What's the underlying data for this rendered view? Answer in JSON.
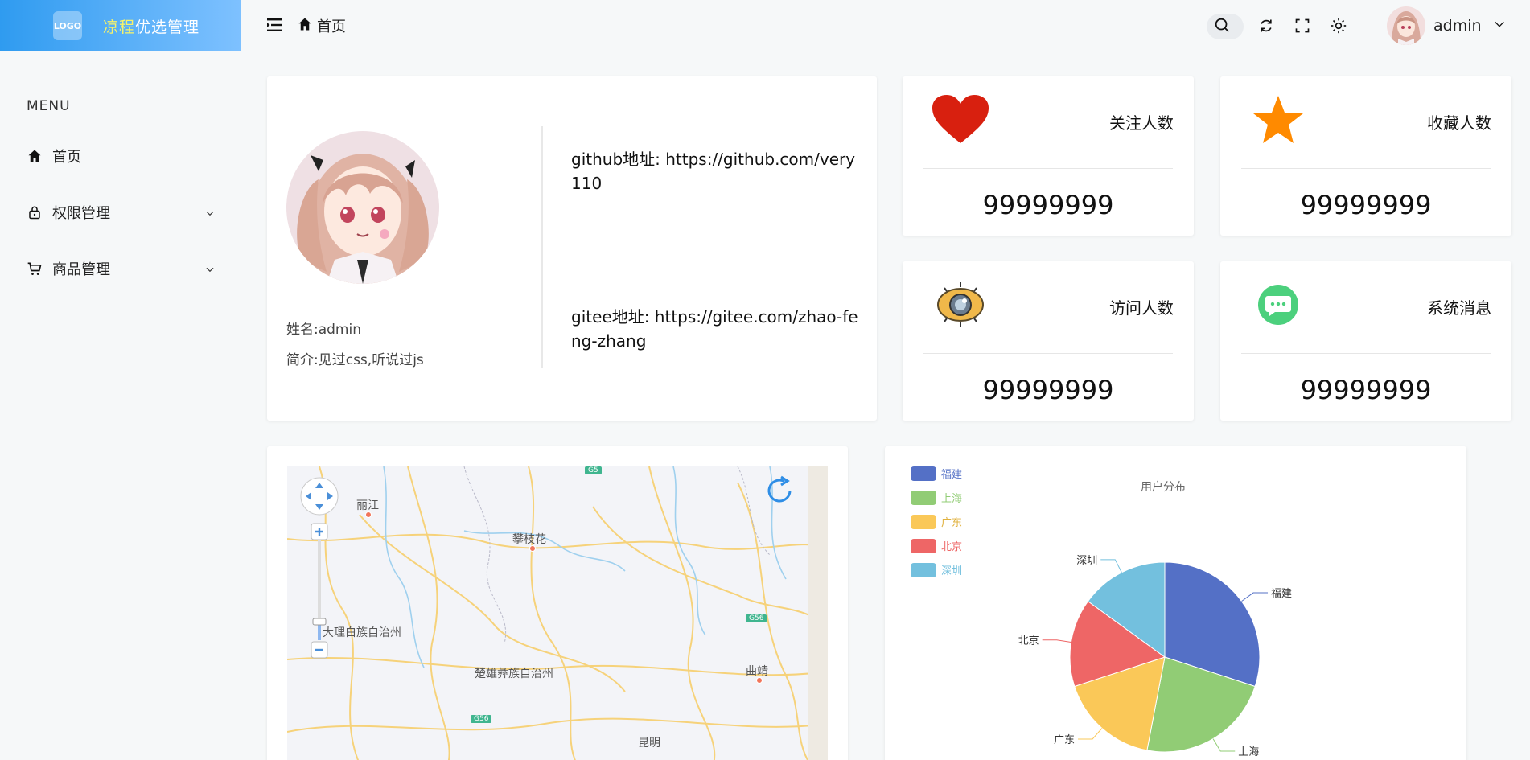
{
  "logo": {
    "box_text": "LOGO",
    "title_part1": "凉程",
    "title_part2": "优选管理"
  },
  "sidebar": {
    "menu_title": "MENU",
    "items": [
      {
        "label": "首页",
        "icon": "home-icon"
      },
      {
        "label": "权限管理",
        "icon": "lock-icon"
      },
      {
        "label": "商品管理",
        "icon": "cart-icon"
      }
    ]
  },
  "header": {
    "breadcrumb": "首页",
    "username": "admin"
  },
  "profile": {
    "name": "姓名:admin",
    "desc": "简介:见过css,听说过js",
    "github": "github地址: https://github.com/very110",
    "gitee": "gitee地址: https://gitee.com/zhao-feng-zhang"
  },
  "stats": [
    {
      "label": "关注人数",
      "value": "99999999",
      "icon": "heart-icon",
      "color": "#d8200f"
    },
    {
      "label": "收藏人数",
      "value": "99999999",
      "icon": "star-icon",
      "color": "#ff8a00"
    },
    {
      "label": "访问人数",
      "value": "99999999",
      "icon": "eye-icon",
      "color": "#f0b84a"
    },
    {
      "label": "系统消息",
      "value": "99999999",
      "icon": "message-icon",
      "color": "#4cd07d"
    }
  ],
  "map": {
    "labels": [
      "丽江",
      "攀枝花",
      "大理白族自治州",
      "楚雄彝族自治州",
      "曲靖",
      "昆明"
    ],
    "shields": [
      "G5",
      "G56",
      "G56"
    ]
  },
  "chart_data": {
    "type": "pie",
    "title": "用户分布",
    "legend_position": "top-left",
    "categories": [
      "福建",
      "上海",
      "广东",
      "北京",
      "深圳"
    ],
    "values": [
      30,
      23,
      17,
      15,
      15
    ],
    "colors": [
      "#5470c6",
      "#91cc75",
      "#fac858",
      "#ee6666",
      "#73c0de"
    ]
  }
}
